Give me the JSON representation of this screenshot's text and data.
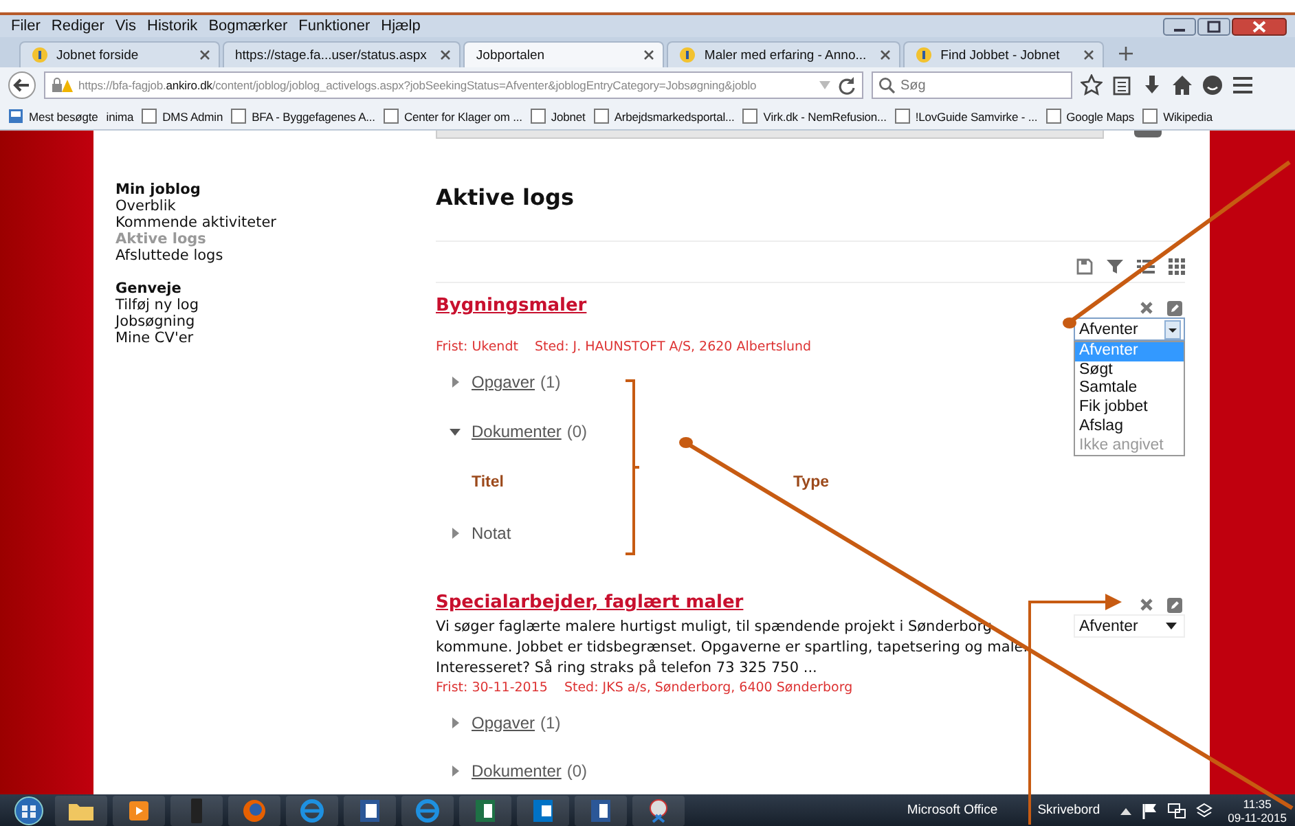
{
  "menu": [
    "Filer",
    "Rediger",
    "Vis",
    "Historik",
    "Bogmærker",
    "Funktioner",
    "Hjælp"
  ],
  "tabs": [
    {
      "label": "Jobnet forside",
      "selected": false,
      "favicon": true
    },
    {
      "label": "https://stage.fa...user/status.aspx",
      "selected": false,
      "favicon": false
    },
    {
      "label": "Jobportalen",
      "selected": true,
      "favicon": false
    },
    {
      "label": "Maler med erfaring - Anno...",
      "selected": false,
      "favicon": true
    },
    {
      "label": "Find Jobbet - Jobnet",
      "selected": false,
      "favicon": true
    }
  ],
  "address": {
    "prefix": "https://bfa-fagjob.",
    "domain": "ankiro.dk",
    "rest": "/content/joblog/joblog_activelogs.aspx?jobSeekingStatus=Afventer&joblogEntryCategory=Jobsøgning&joblo"
  },
  "search": {
    "placeholder": "Søg"
  },
  "bookmarks": [
    {
      "label": "Mest besøgte",
      "icon": true
    },
    {
      "label": "inima",
      "icon": false
    },
    {
      "label": "DMS Admin",
      "icon": true
    },
    {
      "label": "BFA - Byggefagenes A...",
      "icon": true
    },
    {
      "label": "Center for Klager om ...",
      "icon": true
    },
    {
      "label": "Jobnet",
      "icon": true
    },
    {
      "label": "Arbejdsmarkedsportal...",
      "icon": true
    },
    {
      "label": "Virk.dk - NemRefusion...",
      "icon": true
    },
    {
      "label": "!LovGuide Samvirke - ...",
      "icon": true
    },
    {
      "label": "Google Maps",
      "icon": true
    },
    {
      "label": "Wikipedia",
      "icon": true
    }
  ],
  "sidebar": [
    {
      "heading": "Min joblog",
      "items": [
        {
          "label": "Overblik",
          "selected": false
        },
        {
          "label": "Kommende aktiviteter",
          "selected": false
        },
        {
          "label": "Aktive logs",
          "selected": true
        },
        {
          "label": "Afsluttede logs",
          "selected": false
        }
      ]
    },
    {
      "heading": "Genveje",
      "items": [
        {
          "label": "Tilføj ny log",
          "selected": false
        },
        {
          "label": "Jobsøgning",
          "selected": false
        },
        {
          "label": "Mine CV'er",
          "selected": false
        }
      ]
    }
  ],
  "page_title": "Aktive logs",
  "jobs": [
    {
      "title": "Bygningsmaler",
      "deadline": "Frist: Ukendt",
      "place": "Sted: J. HAUNSTOFT A/S, 2620 Albertslund",
      "status": {
        "value": "Afventer",
        "open": true,
        "options": [
          {
            "label": "Afventer",
            "selected": true,
            "disabled": false
          },
          {
            "label": "Søgt",
            "selected": false,
            "disabled": false
          },
          {
            "label": "Samtale",
            "selected": false,
            "disabled": false
          },
          {
            "label": "Fik jobbet",
            "selected": false,
            "disabled": false
          },
          {
            "label": "Afslag",
            "selected": false,
            "disabled": false
          },
          {
            "label": "Ikke angivet",
            "selected": false,
            "disabled": true
          }
        ]
      },
      "sections": [
        {
          "kind": "link",
          "label": "Opgaver",
          "count": "(1)",
          "expanded": false
        },
        {
          "kind": "link",
          "label": "Dokumenter",
          "count": "(0)",
          "expanded": true,
          "columns": [
            "Titel",
            "Type"
          ]
        },
        {
          "kind": "plain",
          "label": "Notat",
          "expanded": false
        }
      ]
    },
    {
      "title": "Specialarbejder, faglært maler",
      "description": "Vi søger faglærte malere hurtigst muligt, til spændende projekt i Sønderborg kommune. Jobbet er tidsbegrænset. Opgaverne er spartling, tapetsering og male. Interesseret? Så ring straks på telefon 73 325 750 ...",
      "deadline": "Frist: 30-11-2015",
      "place": "Sted: JKS a/s, Sønderborg, 6400 Sønderborg",
      "status": {
        "value": "Afventer",
        "open": false
      },
      "sections": [
        {
          "kind": "link",
          "label": "Opgaver",
          "count": "(1)",
          "expanded": false
        },
        {
          "kind": "link",
          "label": "Dokumenter",
          "count": "(0)",
          "expanded": false
        }
      ]
    }
  ],
  "taskbar": {
    "toolbars": [
      "Microsoft Office",
      "Skrivebord"
    ],
    "time": "11:35",
    "date": "09-11-2015"
  }
}
